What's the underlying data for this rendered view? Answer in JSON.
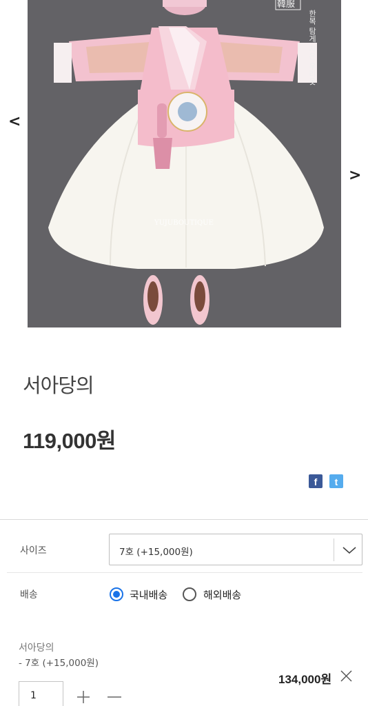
{
  "gallery": {
    "prev_arrow": "<",
    "next_arrow": ">",
    "image_stamp": "韓服",
    "image_watermark": "YUJUBOUTIQUE",
    "image_caption": "한복 탐게 지은 우리옷"
  },
  "product": {
    "title": "서아당의",
    "price": "119,000원"
  },
  "share": {
    "facebook": "f",
    "twitter": "t"
  },
  "options": {
    "size_label": "사이즈",
    "size_selected": "7호 (+15,000원)",
    "shipping_label": "배송",
    "shipping_domestic": "국내배송",
    "shipping_overseas": "해외배송",
    "shipping_selected": "국내배송"
  },
  "selected_item": {
    "name": "서아당의",
    "option": "- 7호 (+15,000원)",
    "price": "134,000원",
    "quantity": "1"
  },
  "colors": {
    "accent": "#1a73e8",
    "facebook": "#3b5998",
    "twitter": "#55acee"
  }
}
